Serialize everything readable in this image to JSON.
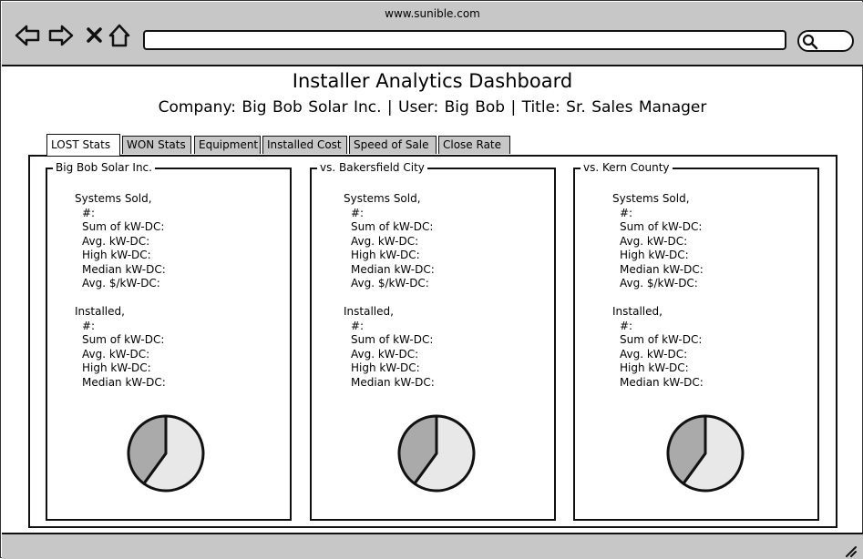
{
  "browser": {
    "url": "www.sunible.com",
    "address_value": "",
    "search_value": "",
    "icons": [
      "back-arrow-icon",
      "forward-arrow-icon",
      "close-icon",
      "home-icon",
      "search-icon"
    ]
  },
  "header": {
    "title": "Installer Analytics Dashboard",
    "subtitle": "Company: Big Bob Solar Inc.  |  User: Big Bob  |  Title: Sr. Sales Manager"
  },
  "tabs": [
    {
      "label": "LOST Stats",
      "active": true
    },
    {
      "label": "WON Stats",
      "active": false
    },
    {
      "label": "Equipment",
      "active": false
    },
    {
      "label": "Installed Cost",
      "active": false
    },
    {
      "label": "Speed of Sale",
      "active": false
    },
    {
      "label": "Close Rate",
      "active": false
    }
  ],
  "cards": [
    {
      "title": "Big Bob Solar Inc.",
      "sold_heading": "Systems Sold,",
      "sold_items": [
        "#:",
        "Sum of kW-DC:",
        "Avg. kW-DC:",
        "High kW-DC:",
        "Median kW-DC:",
        "Avg. $/kW-DC:"
      ],
      "installed_heading": "Installed,",
      "installed_items": [
        "#:",
        "Sum of kW-DC:",
        "Avg. kW-DC:",
        "High kW-DC:",
        "Median kW-DC:"
      ]
    },
    {
      "title": "vs. Bakersfield City",
      "sold_heading": "Systems Sold,",
      "sold_items": [
        "#:",
        "Sum of kW-DC:",
        "Avg. kW-DC:",
        "High kW-DC:",
        "Median kW-DC:",
        "Avg. $/kW-DC:"
      ],
      "installed_heading": "Installed,",
      "installed_items": [
        "#:",
        "Sum of kW-DC:",
        "Avg. kW-DC:",
        "High kW-DC:",
        "Median kW-DC:"
      ]
    },
    {
      "title": "vs. Kern County",
      "sold_heading": "Systems Sold,",
      "sold_items": [
        "#:",
        "Sum of kW-DC:",
        "Avg. kW-DC:",
        "High kW-DC:",
        "Median kW-DC:",
        "Avg. $/kW-DC:"
      ],
      "installed_heading": "Installed,",
      "installed_items": [
        "#:",
        "Sum of kW-DC:",
        "Avg. kW-DC:",
        "High kW-DC:",
        "Median kW-DC:"
      ]
    }
  ],
  "pie": {
    "slice_fractions": [
      0.6,
      0.4
    ],
    "colors": [
      "#e8e8e8",
      "#aaaaaa"
    ]
  }
}
